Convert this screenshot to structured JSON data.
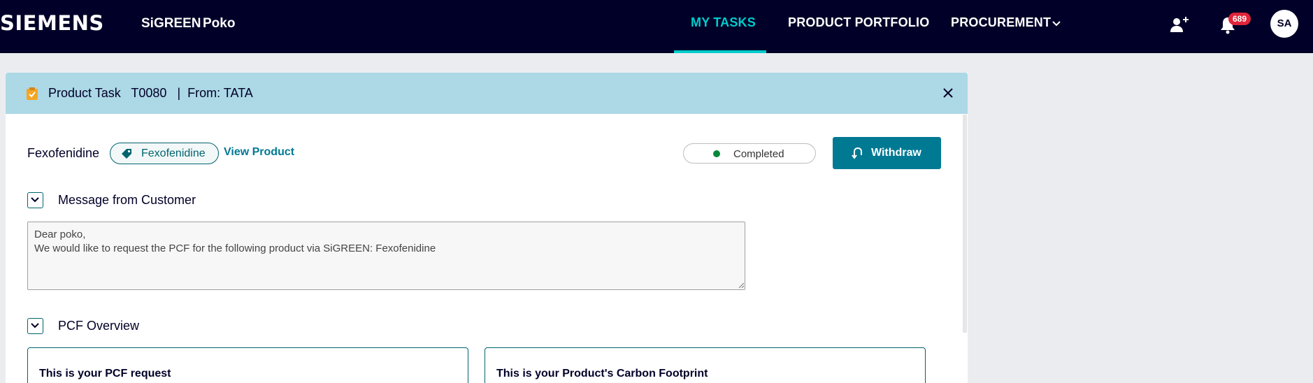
{
  "header": {
    "logo": "SIEMENS",
    "app_name": "SiGREEN",
    "org_name": "Poko",
    "nav": [
      {
        "label": "MY TASKS",
        "active": true
      },
      {
        "label": "PRODUCT PORTFOLIO",
        "active": false
      },
      {
        "label": "PROCUREMENT",
        "active": false
      }
    ],
    "notification_count": "689",
    "avatar_initials": "SA",
    "accent_color": "#00cccc",
    "bg_color": "#000028"
  },
  "task": {
    "title": "Product Task   T0080   |  From: TATA",
    "product_name": "Fexofenidine",
    "tag_label": "Fexofenidine",
    "view_product_label": "View Product",
    "status": "Completed",
    "status_color": "#01893a",
    "withdraw_label": "Withdraw",
    "sections": {
      "message_title": "Message from Customer",
      "message_text": "Dear poko,\nWe would like to request the PCF for the following product via SiGREEN: Fexofenidine",
      "pcf_title": "PCF Overview"
    },
    "cards": [
      {
        "title": "This is your PCF request"
      },
      {
        "title": "This is your Product's Carbon Footprint"
      }
    ]
  }
}
